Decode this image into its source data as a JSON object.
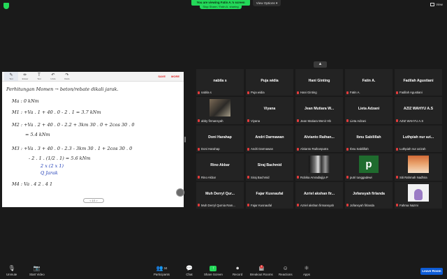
{
  "top": {
    "sharing_banner": "You are viewing Fatin A.'s screen",
    "share_tab": "Stop Share / Fatin A. sharing",
    "view_options": "View Options ▾",
    "view_label": "View"
  },
  "whiteboard": {
    "tools": [
      {
        "icon": "✎",
        "label": "Text"
      },
      {
        "icon": "✏",
        "label": "Eraser"
      },
      {
        "icon": "T",
        "label": "Text"
      },
      {
        "icon": "↶",
        "label": "Undo"
      },
      {
        "icon": "↷",
        "label": "Redo"
      }
    ],
    "save_label": "SAVE",
    "more_label": "MORE",
    "page_indicator": "< 1/1 >",
    "lines": [
      "Perhitungan Momen → beton/rebate dikali jarak.",
      "Ma : 0 kNm",
      "M1 : +Va . 1 + 40 . 0 - 2 . 1 = 3.7 kNm",
      "M2 : +Va . 2 + 40 . 0 - 2.2 + 3km 30 . 0 + 2cos 30 . 0",
      "= 5.4 kNm",
      "M3 : +Va . 3 + 40 . 0 - 2.3 - 3km 30 . 1 + 2cos 30 . 0",
      "- 2 . 1 . (1/2 . 1) = 5.6 kNm",
      "2 x      (2 x 1)",
      "Q        Jarak",
      "M4 : Va . 4          2 . 4          1"
    ]
  },
  "gallery": {
    "tiles": [
      {
        "name": "nabila s",
        "label": "nabila s",
        "pic": ""
      },
      {
        "name": "Puja widia",
        "label": "Puja widia",
        "pic": ""
      },
      {
        "name": "Hani Ginting",
        "label": "Hani Ginting",
        "pic": ""
      },
      {
        "name": "Fatin A.",
        "label": "Fatin A.",
        "pic": ""
      },
      {
        "name": "Fadilah Agustiani",
        "label": "Fadilah Agustiani",
        "pic": ""
      },
      {
        "name": "",
        "label": "abby firmansyah",
        "pic": "photo"
      },
      {
        "name": "Viyana",
        "label": "Viyana",
        "pic": ""
      },
      {
        "name": "Jean Mutiara W...",
        "label": "Jean Mutiara Wenir Hb",
        "pic": ""
      },
      {
        "name": "Lieta Adzani",
        "label": "Lieta Adzani",
        "pic": ""
      },
      {
        "name": "AZIZ WAHYU A.S",
        "label": "AZIZ WAHYU A.S",
        "pic": ""
      },
      {
        "name": "Doni Harahap",
        "label": "Doni Harahap",
        "pic": ""
      },
      {
        "name": "Andri Darmawan",
        "label": "Andri Darmawan",
        "pic": ""
      },
      {
        "name": "Alvianto Raihan...",
        "label": "Alvianto Raihanputra",
        "pic": ""
      },
      {
        "name": "Ibnu Sabilillah",
        "label": "Ibnu Sabilillah",
        "pic": ""
      },
      {
        "name": "Luthpiah nur azi...",
        "label": "Luthpiah nur azizah",
        "pic": ""
      },
      {
        "name": "Rino Akbar",
        "label": "Rino Akbar",
        "pic": ""
      },
      {
        "name": "Siraj Bachmid",
        "label": "Siraj Bachmid",
        "pic": ""
      },
      {
        "name": "",
        "label": "Robika Amradiajija P",
        "pic": "bw"
      },
      {
        "name": "",
        "label": "putri tunggadewi",
        "pic": "p"
      },
      {
        "name": "",
        "label": "Siti Rahmah Nadhira",
        "pic": "anime"
      },
      {
        "name": "Muh Derryl Qur...",
        "label": "Muh Derryl Qurnia Ram...",
        "pic": ""
      },
      {
        "name": "Fajar Kusnaufal",
        "label": "Fajar Kusnaufal",
        "pic": ""
      },
      {
        "name": "Azriel akshan fir...",
        "label": "Azriel akshan firmansyah",
        "pic": ""
      },
      {
        "name": "Jofansyah firlanda",
        "label": "Jofansyah firlanda",
        "pic": ""
      },
      {
        "name": "",
        "label": "Fahma Nazmi",
        "pic": "hijab"
      }
    ]
  },
  "toolbar": {
    "unmute": "Unmute",
    "start_video": "Start Video",
    "participants": "Participants",
    "participants_count": "34",
    "chat": "Chat",
    "share_screen": "Share Screen",
    "record": "Record",
    "breakout_rooms": "Breakout Rooms",
    "breakout_badge": "1",
    "reactions": "Reactions",
    "apps": "Apps",
    "leave": "Leave Room"
  }
}
